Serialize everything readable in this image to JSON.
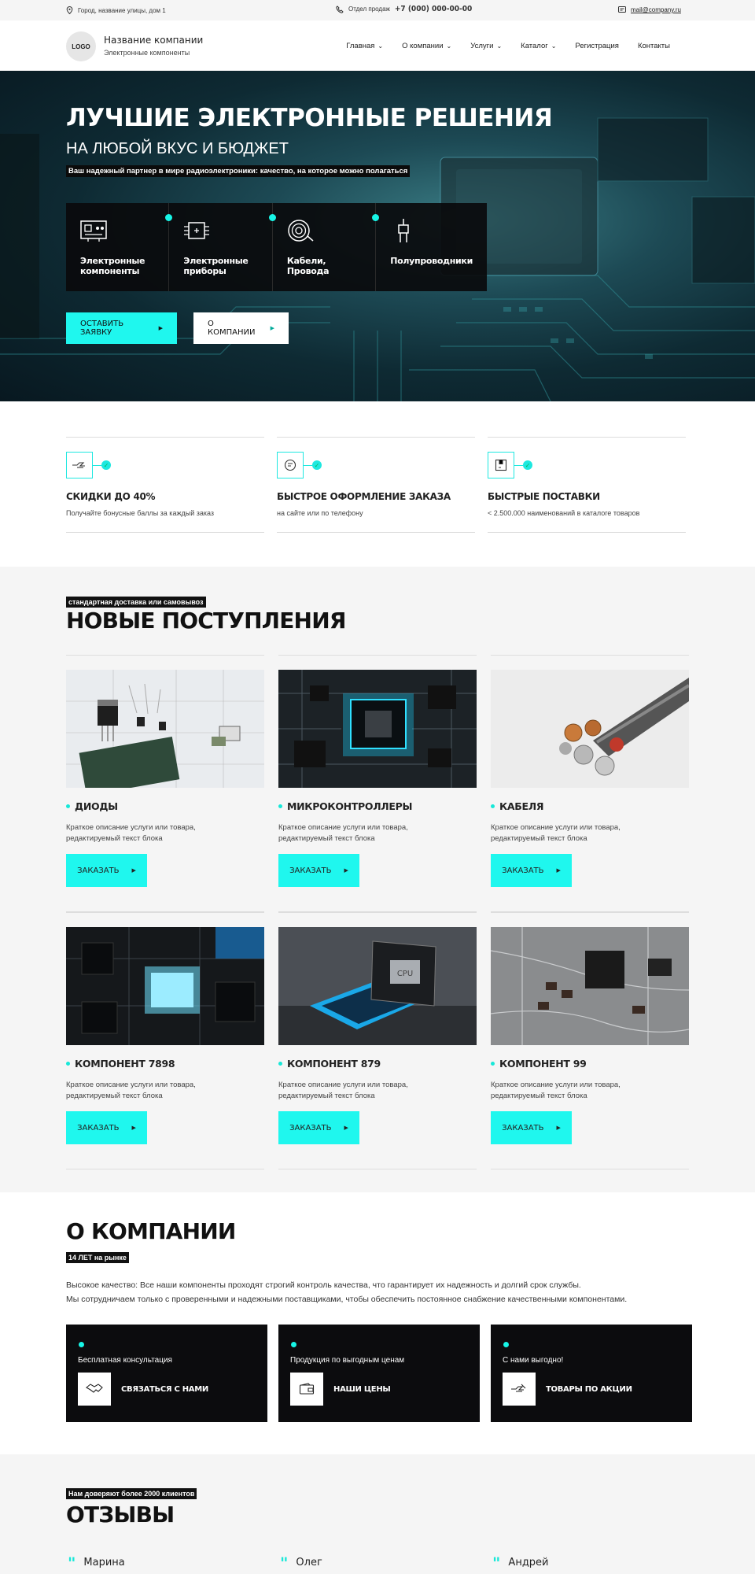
{
  "topbar": {
    "address": "Город, название улицы, дом 1",
    "phone_label": "Отдел продаж",
    "phone": "+7 (000) 000-00-00",
    "email": "mail@company.ru"
  },
  "header": {
    "logo": "LOGO",
    "company_name": "Название компании",
    "company_sub": "Электронные компоненты",
    "nav": [
      {
        "label": "Главная",
        "dropdown": true
      },
      {
        "label": "О компании",
        "dropdown": true
      },
      {
        "label": "Услуги",
        "dropdown": true
      },
      {
        "label": "Каталог",
        "dropdown": true
      },
      {
        "label": "Регистрация",
        "dropdown": false
      },
      {
        "label": "Контакты",
        "dropdown": false
      }
    ]
  },
  "hero": {
    "title": "ЛУЧШИЕ ЭЛЕКТРОННЫЕ РЕШЕНИЯ",
    "subtitle": "НА ЛЮБОЙ ВКУС И БЮДЖЕТ",
    "tagline": "Ваш надежный партнер в мире радиоэлектроники: качество, на которое можно полагаться",
    "cards": [
      {
        "label": "Электронные компоненты",
        "icon": "circuit-board-icon"
      },
      {
        "label": "Электронные приборы",
        "icon": "chip-icon"
      },
      {
        "label": "Кабели, Провода",
        "icon": "cable-coil-icon"
      },
      {
        "label": "Полупроводники",
        "icon": "semiconductor-icon"
      }
    ],
    "btn_request": "ОСТАВИТЬ ЗАЯВКУ",
    "btn_about": "О КОМПАНИИ"
  },
  "features": [
    {
      "title": "СКИДКИ  ДО  40%",
      "desc": "Получайте бонусные баллы за каждый заказ",
      "icon": "discount-hand-icon"
    },
    {
      "title": "БЫСТРОЕ ОФОРМЛЕНИЕ ЗАКАЗА",
      "desc": "на сайте или по телефону",
      "icon": "chat-support-icon"
    },
    {
      "title": "БЫСТРЫЕ ПОСТАВКИ",
      "desc": "< 2.500.000 наименований в каталоге товаров",
      "icon": "delivery-box-icon"
    }
  ],
  "products": {
    "badge": "стандартная доставка или самовывоз",
    "title": "НОВЫЕ ПОСТУПЛЕНИЯ",
    "order_label": "ЗАКАЗАТЬ",
    "items": [
      {
        "title": "ДИОДЫ",
        "desc": "Краткое описание услуги или товара, редактируемый текст блока"
      },
      {
        "title": "МИКРОКОНТРОЛЛЕРЫ",
        "desc": "Краткое описание услуги или товара, редактируемый текст блока"
      },
      {
        "title": "КАБЕЛЯ",
        "desc": "Краткое описание услуги или товара, редактируемый текст блока"
      },
      {
        "title": "КОМПОНЕНТ  7898",
        "desc": "Краткое описание услуги или товара, редактируемый текст блока"
      },
      {
        "title": "КОМПОНЕНТ  879",
        "desc": "Краткое описание услуги или товара, редактируемый текст блока"
      },
      {
        "title": "КОМПОНЕНТ  99",
        "desc": "Краткое описание услуги или товара, редактируемый текст блока"
      }
    ],
    "cpu_label": "CPU"
  },
  "about": {
    "title": "О КОМПАНИИ",
    "badge": "14 ЛЕТ на рынке",
    "text1": "Высокое качество: Все наши компоненты проходят строгий контроль качества, что гарантирует их надежность и долгий срок службы.",
    "text2": "Мы сотрудничаем только с проверенными и надежными поставщиками, чтобы обеспечить постоянное снабжение качественными компонентами.",
    "cards": [
      {
        "text": "Бесплатная консультация",
        "link": "СВЯЗАТЬСЯ С НАМИ",
        "icon": "handshake-icon"
      },
      {
        "text": "Продукция по выгодным ценам",
        "link": "НАШИ ЦЕНЫ",
        "icon": "wallet-icon"
      },
      {
        "text": "С нами выгодно!",
        "link": "ТОВАРЫ  ПО АКЦИИ",
        "icon": "discount-hand-icon"
      }
    ]
  },
  "reviews": {
    "badge": "Нам доверяют более 2000 клиентов",
    "title": "ОТЗЫВЫ",
    "names": [
      "Марина",
      "Олег",
      "Андрей"
    ]
  }
}
